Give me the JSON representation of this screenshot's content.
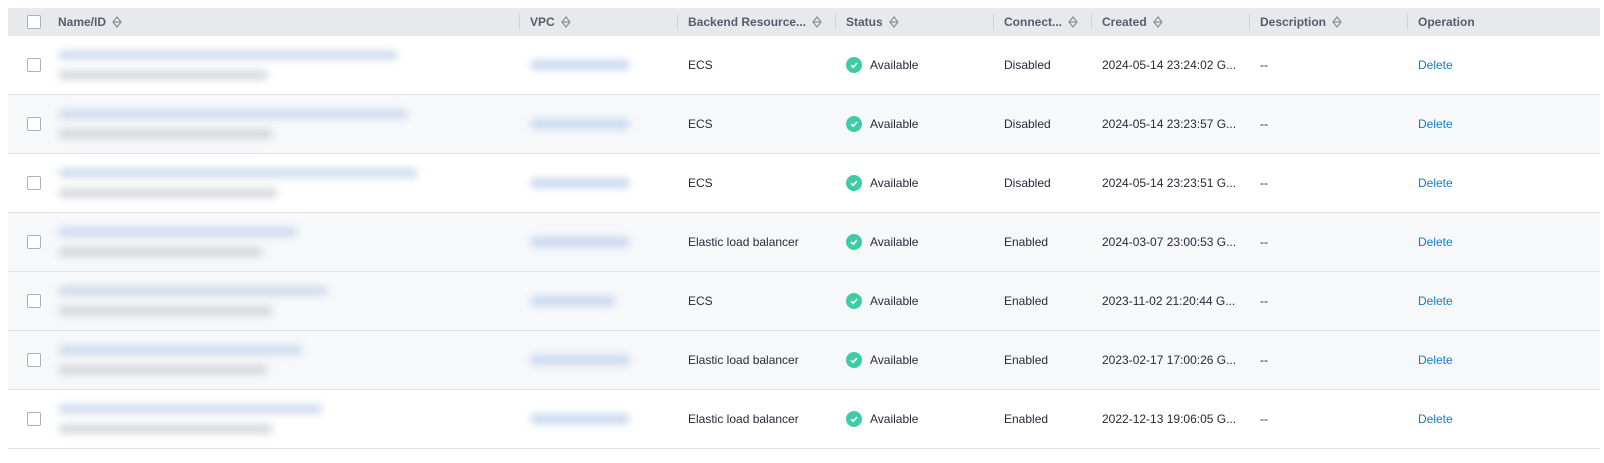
{
  "columns": {
    "name": "Name/ID",
    "vpc": "VPC",
    "backend": "Backend Resource...",
    "status": "Status",
    "connection": "Connect...",
    "created": "Created",
    "description": "Description",
    "operation": "Operation"
  },
  "colors": {
    "accent": "#0e7fc4",
    "status_ok": "#3dcca6",
    "header_bg": "#e8e9ec"
  },
  "rows": [
    {
      "backend": "ECS",
      "status": "Available",
      "connection": "Disabled",
      "created": "2024-05-14 23:24:02 G...",
      "description": "--",
      "operation": "Delete"
    },
    {
      "backend": "ECS",
      "status": "Available",
      "connection": "Disabled",
      "created": "2024-05-14 23:23:57 G...",
      "description": "--",
      "operation": "Delete"
    },
    {
      "backend": "ECS",
      "status": "Available",
      "connection": "Disabled",
      "created": "2024-05-14 23:23:51 G...",
      "description": "--",
      "operation": "Delete"
    },
    {
      "backend": "Elastic load balancer",
      "status": "Available",
      "connection": "Enabled",
      "created": "2024-03-07 23:00:53 G...",
      "description": "--",
      "operation": "Delete"
    },
    {
      "backend": "ECS",
      "status": "Available",
      "connection": "Enabled",
      "created": "2023-11-02 21:20:44 G...",
      "description": "--",
      "operation": "Delete"
    },
    {
      "backend": "Elastic load balancer",
      "status": "Available",
      "connection": "Enabled",
      "created": "2023-02-17 17:00:26 G...",
      "description": "--",
      "operation": "Delete"
    },
    {
      "backend": "Elastic load balancer",
      "status": "Available",
      "connection": "Enabled",
      "created": "2022-12-13 19:06:05 G...",
      "description": "--",
      "operation": "Delete"
    }
  ]
}
